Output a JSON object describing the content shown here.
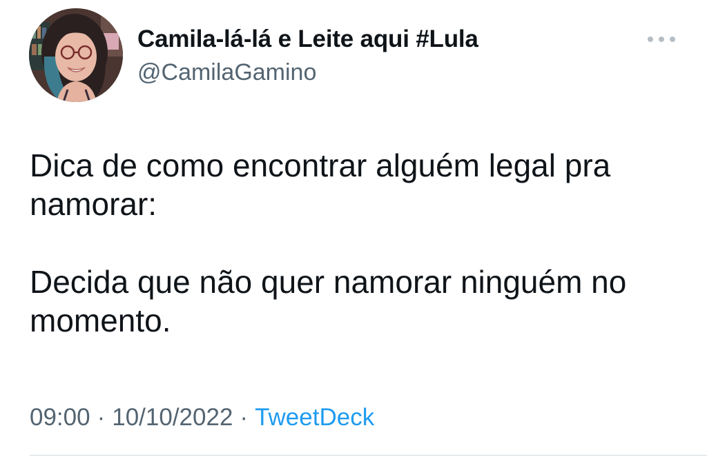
{
  "tweet": {
    "author": {
      "display_name": "Camila-lá-lá e Leite aqui #Lula",
      "handle": "@CamilaGamino"
    },
    "text": {
      "paragraph_1": "Dica de como encontrar alguém legal pra namorar:",
      "paragraph_2": "Decida que não quer namorar ninguém no momento."
    },
    "meta": {
      "time": "09:00",
      "separator": "·",
      "date": "10/10/2022",
      "source": "TweetDeck"
    },
    "icons": {
      "more": "more-options-icon",
      "avatar": "profile-photo"
    },
    "colors": {
      "text_primary": "#0f1419",
      "text_secondary": "#536471",
      "link": "#1d9bf0",
      "divider": "#cfd9de"
    }
  }
}
